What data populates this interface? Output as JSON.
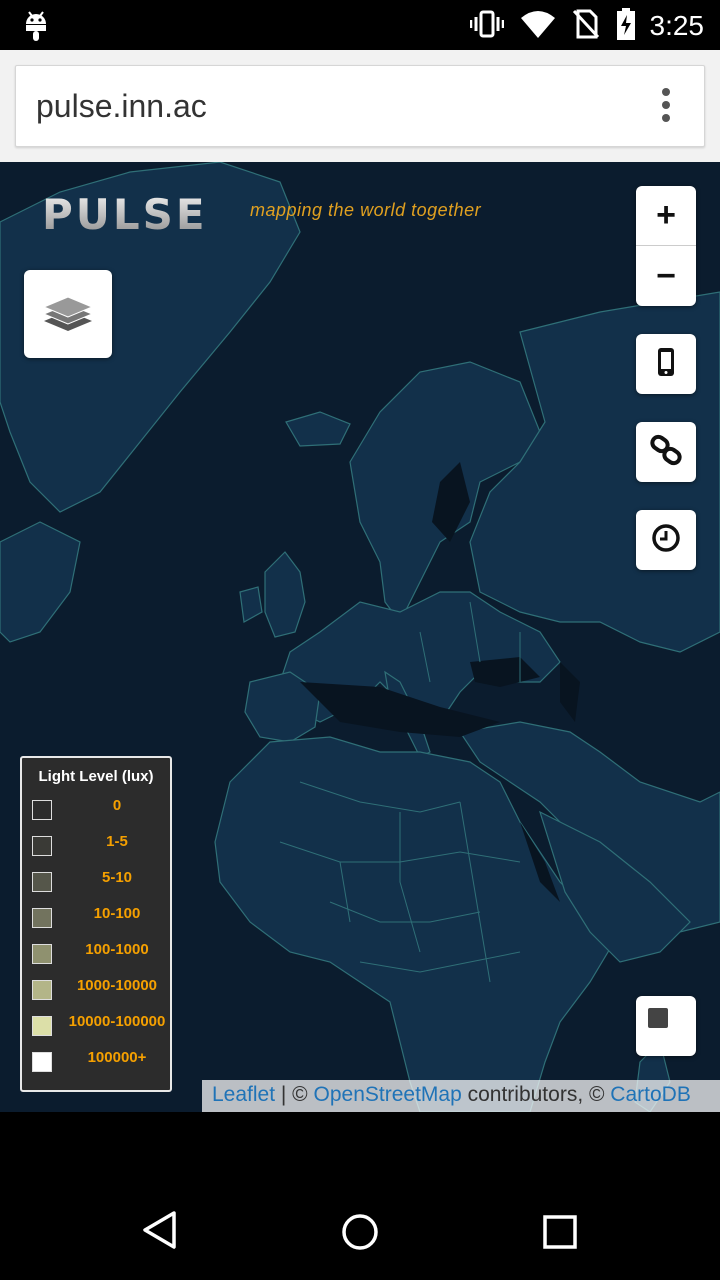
{
  "status_bar": {
    "time": "3:25",
    "icons": [
      "android-icon",
      "vibrate-icon",
      "wifi-icon",
      "no-sim-icon",
      "battery-charging-icon"
    ]
  },
  "browser": {
    "url": "pulse.inn.ac",
    "menu_icon": "more-vert-icon"
  },
  "header": {
    "logo_text": "PULSE",
    "tagline": "mapping the world together"
  },
  "controls": {
    "zoom_in": "+",
    "zoom_out": "−",
    "layers_icon": "layers-icon",
    "right_buttons": [
      "phone-icon",
      "link-icon",
      "clock-icon"
    ],
    "stop_icon": "stop-square-icon"
  },
  "legend": {
    "title": "Light Level (lux)",
    "items": [
      {
        "label": "0",
        "color": "#2c2c2c"
      },
      {
        "label": "1-5",
        "color": "#3a3a36"
      },
      {
        "label": "5-10",
        "color": "#55564a"
      },
      {
        "label": "10-100",
        "color": "#72735e"
      },
      {
        "label": "100-1000",
        "color": "#8f916f"
      },
      {
        "label": "1000-10000",
        "color": "#b3b588"
      },
      {
        "label": "10000-100000",
        "color": "#dcdfa8"
      },
      {
        "label": "100000+",
        "color": "#ffffff"
      }
    ]
  },
  "attribution": {
    "leaflet": "Leaflet",
    "sep1": " | © ",
    "osm": "OpenStreetMap",
    "middle": " contributors, © ",
    "carto": "CartoDB"
  },
  "nav_bar": {
    "icons": [
      "back-icon",
      "home-icon",
      "recents-icon"
    ]
  },
  "colors": {
    "ocean": "#0b1c2e",
    "land": "#12304a",
    "borders": "#2f6f77",
    "accent": "#e0a020"
  }
}
